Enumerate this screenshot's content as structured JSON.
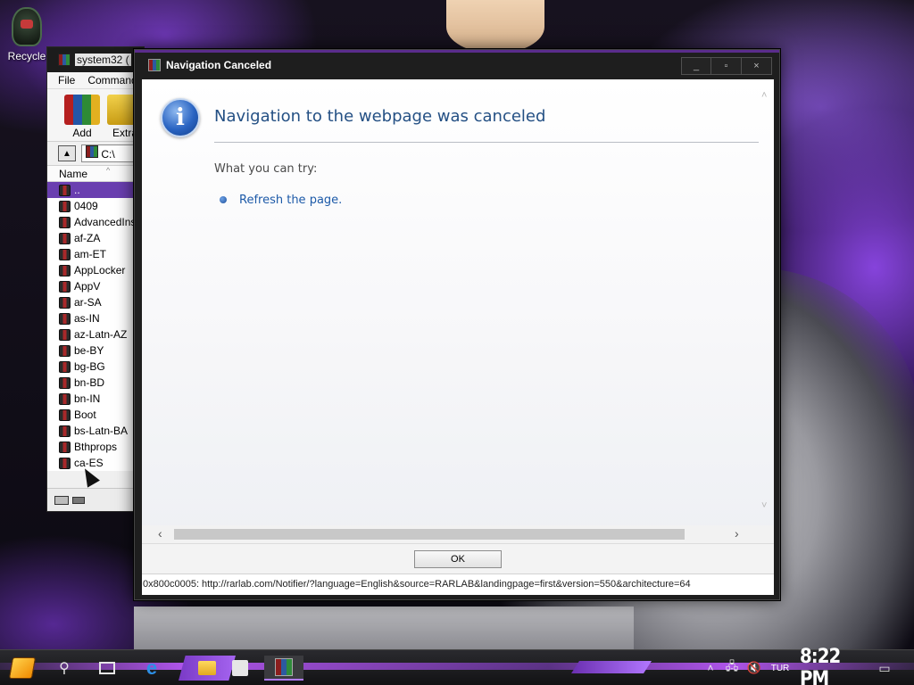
{
  "desktop": {
    "recycle_label": "Recycle"
  },
  "winrar": {
    "title": "system32 (",
    "menu": [
      "File",
      "Command"
    ],
    "toolbar": {
      "add_label": "Add",
      "extract_label": "Extra"
    },
    "path": "C:\\",
    "column_name": "Name",
    "files": [
      "..",
      "0409",
      "AdvancedInst",
      "af-ZA",
      "am-ET",
      "AppLocker",
      "AppV",
      "ar-SA",
      "as-IN",
      "az-Latn-AZ",
      "be-BY",
      "bg-BG",
      "bn-BD",
      "bn-IN",
      "Boot",
      "bs-Latn-BA",
      "Bthprops",
      "ca-ES"
    ]
  },
  "dialog": {
    "title": "Navigation Canceled",
    "window_buttons": {
      "minimize": "_",
      "maximize": "▫",
      "close": "×"
    },
    "heading": "Navigation to the webpage was canceled",
    "try_label": "What you can try:",
    "refresh_link": "Refresh the page.",
    "ok_label": "OK",
    "status": "0x800c0005: http://rarlab.com/Notifier/?language=English&source=RARLAB&landingpage=first&version=550&architecture=64"
  },
  "taskbar": {
    "lang": "TUR",
    "clock": "8:22 PM"
  },
  "colors": {
    "accent_purple": "#6a3fb0",
    "heading_blue": "#245084",
    "link_blue": "#1d5aa8"
  }
}
